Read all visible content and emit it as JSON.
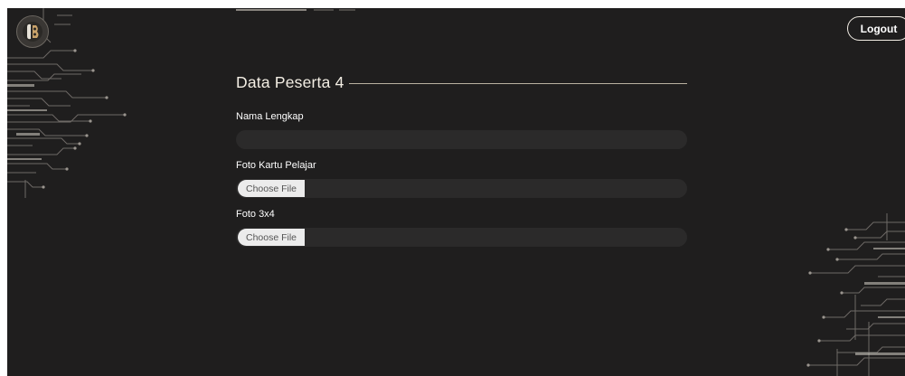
{
  "header": {
    "logout_label": "Logout"
  },
  "section": {
    "title": "Data Peserta 4"
  },
  "fields": [
    {
      "label": "Nama Lengkap",
      "value": ""
    },
    {
      "label": "Foto Kartu Pelajar",
      "button": "Choose File"
    },
    {
      "label": "Foto 3x4",
      "button": "Choose File"
    }
  ],
  "colors": {
    "background": "#1f1e1e",
    "input": "#2b2a2a",
    "accent_line": "#b9b1a1"
  },
  "icons": {
    "logo": "circuit-logo-icon"
  }
}
